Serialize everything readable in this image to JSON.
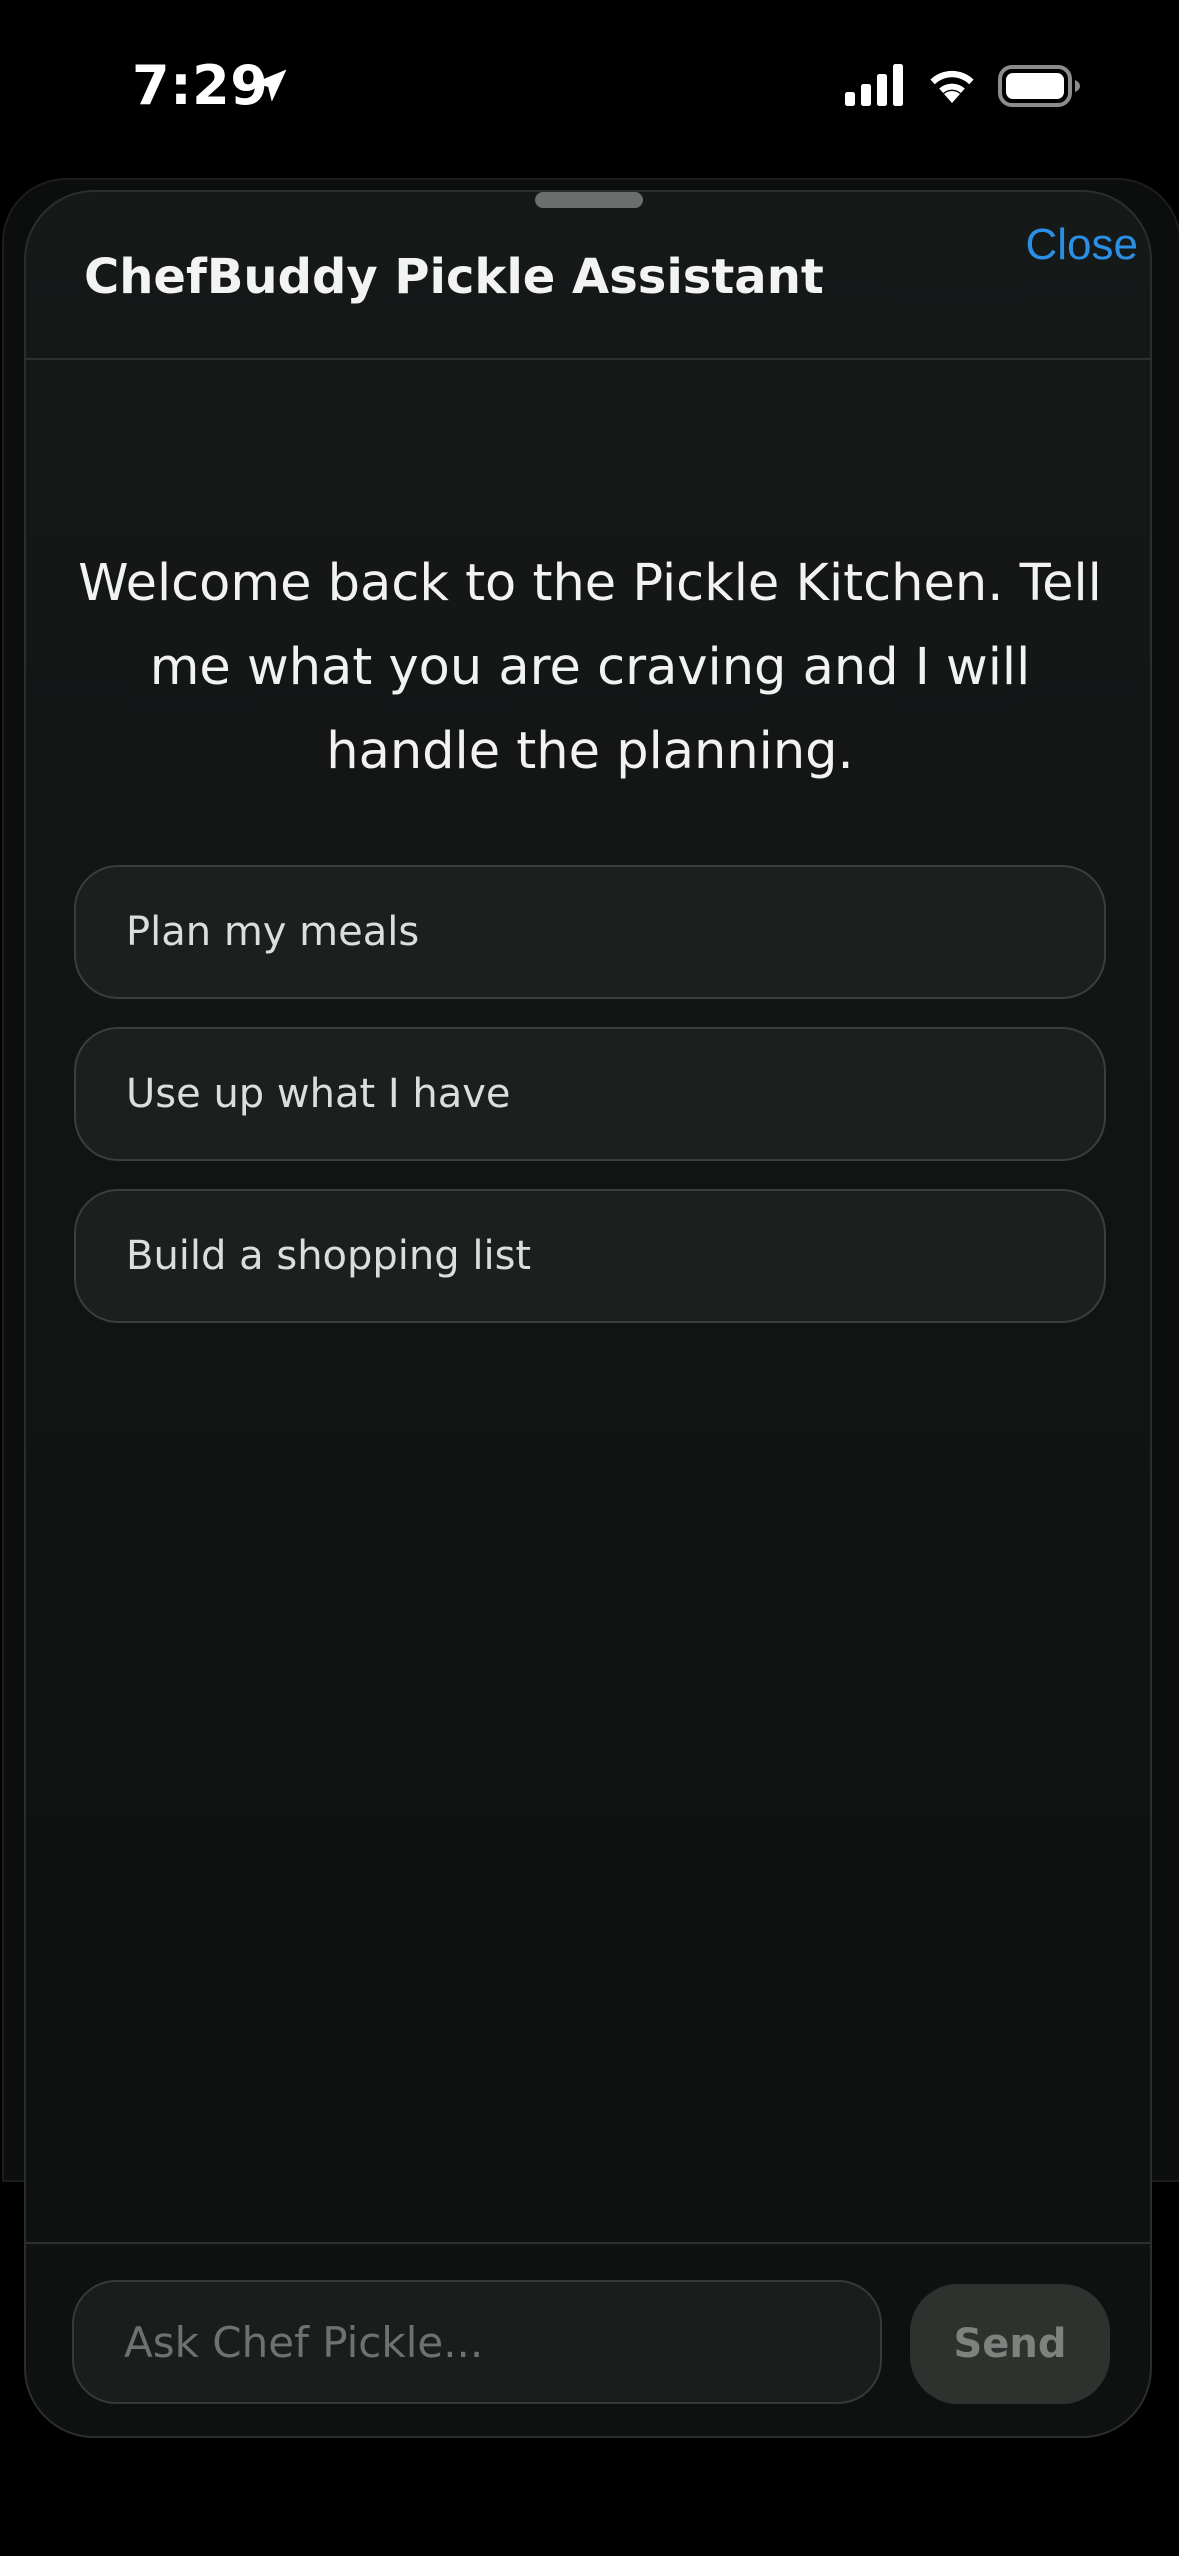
{
  "status_bar": {
    "time": "7:29",
    "icons": [
      "location-arrow-icon",
      "cellular-signal-icon",
      "wifi-icon",
      "battery-icon"
    ]
  },
  "sheet": {
    "title": "ChefBuddy Pickle Assistant",
    "close_label": "Close"
  },
  "welcome": {
    "message": "Welcome back to the Pickle Kitchen. Tell me what you are craving and I will handle the planning."
  },
  "suggestions": [
    {
      "label": "Plan my meals"
    },
    {
      "label": "Use up what I have"
    },
    {
      "label": "Build a shopping list"
    }
  ],
  "composer": {
    "placeholder": "Ask Chef Pickle...",
    "value": "",
    "send_label": "Send"
  },
  "colors": {
    "accent": "#2b8fe6",
    "background": "#000000",
    "sheet": "#131716",
    "chip": "#1c1f1e",
    "send_disabled": "#2d322f"
  }
}
